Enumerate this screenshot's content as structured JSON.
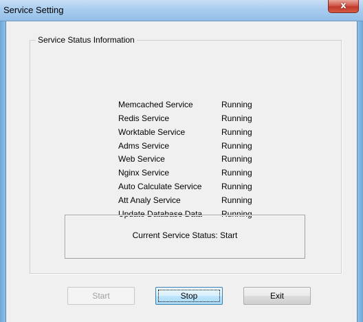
{
  "window": {
    "title": "Service Setting",
    "close_label": "x"
  },
  "group": {
    "title": "Service Status Information"
  },
  "services": [
    {
      "name": "Memcached Service",
      "status": "Running"
    },
    {
      "name": "Redis Service",
      "status": "Running"
    },
    {
      "name": "Worktable Service",
      "status": "Running"
    },
    {
      "name": "Adms Service",
      "status": "Running"
    },
    {
      "name": "Web Service",
      "status": "Running"
    },
    {
      "name": "Nginx Service",
      "status": "Running"
    },
    {
      "name": "Auto Calculate Service",
      "status": "Running"
    },
    {
      "name": "Att Analy Service",
      "status": "Running"
    },
    {
      "name": "Update Database Data",
      "status": "Running"
    }
  ],
  "current_status": "Current Service Status: Start",
  "buttons": {
    "start": "Start",
    "stop": "Stop",
    "exit": "Exit"
  },
  "colors": {
    "titlebar": "#a9cdef",
    "close_button": "#c0392b",
    "client_bg": "#f0f0f0",
    "disabled_text": "#a0a0a0"
  }
}
